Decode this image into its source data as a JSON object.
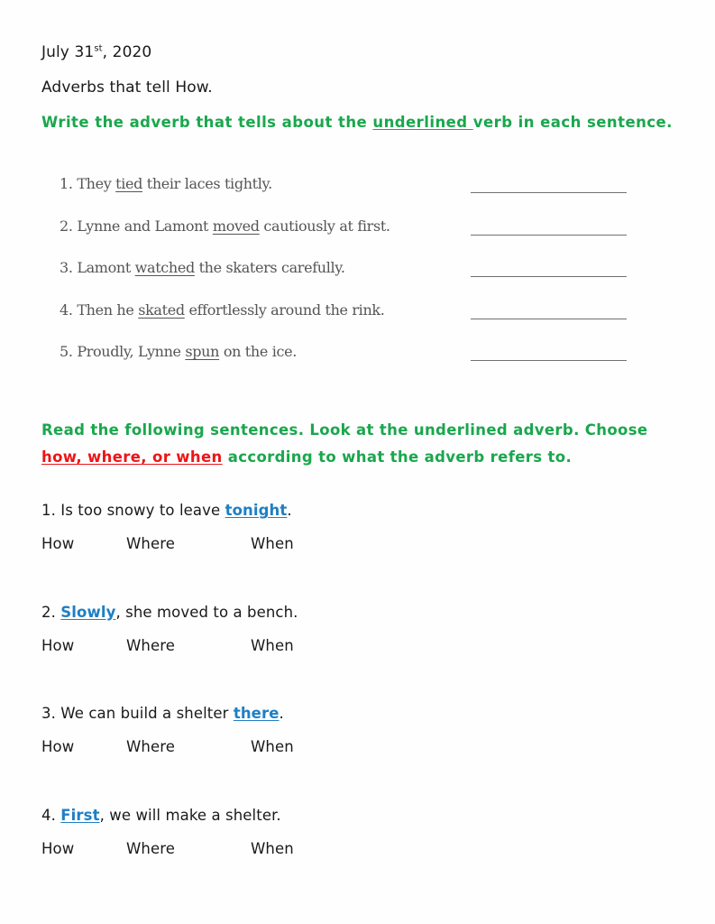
{
  "document": {
    "date": "July 31",
    "date_ordinal": "st",
    "date_year": ", 2020",
    "subtitle": "Adverbs that tell How."
  },
  "instruction_1": {
    "before": "Write the adverb that tells about the ",
    "underlined": "underlined ",
    "after": "verb in each sentence."
  },
  "exercise_1": {
    "items": [
      {
        "number": "1. ",
        "pre": "They ",
        "verb": "tied",
        "post": " their laces tightly."
      },
      {
        "number": "2. ",
        "pre": "Lynne and Lamont ",
        "verb": "moved",
        "post": " cautiously at first."
      },
      {
        "number": "3. ",
        "pre": "Lamont ",
        "verb": "watched",
        "post": " the skaters carefully."
      },
      {
        "number": "4. ",
        "pre": "Then he ",
        "verb": "skated",
        "post": " effortlessly around the rink."
      },
      {
        "number": "5. ",
        "pre": "Proudly, Lynne ",
        "verb": "spun",
        "post": " on the ice."
      }
    ]
  },
  "instruction_2": {
    "part1": "Read the following sentences.  Look at the underlined adverb.  Choose ",
    "red": "how, where, or when",
    "part2": " according to what the adverb refers to."
  },
  "exercise_2": {
    "options": [
      "How",
      "Where",
      "When"
    ],
    "items": [
      {
        "number": "1. ",
        "pre": "Is too snowy to leave ",
        "adverb": "tonight",
        "post": "."
      },
      {
        "number": "2. ",
        "pre": "",
        "adverb": "Slowly",
        "post": ", she moved to a bench."
      },
      {
        "number": "3. ",
        "pre": "We can build a shelter ",
        "adverb": "there",
        "post": "."
      },
      {
        "number": "4. ",
        "pre": "",
        "adverb": "First",
        "post": ", we will make a shelter."
      }
    ]
  },
  "colors": {
    "green": "#1aa74d",
    "red": "#ee1418",
    "blue": "#1f7fc4",
    "gray_text": "#555558",
    "rule": "#707074",
    "black": "#1a1a1a"
  }
}
